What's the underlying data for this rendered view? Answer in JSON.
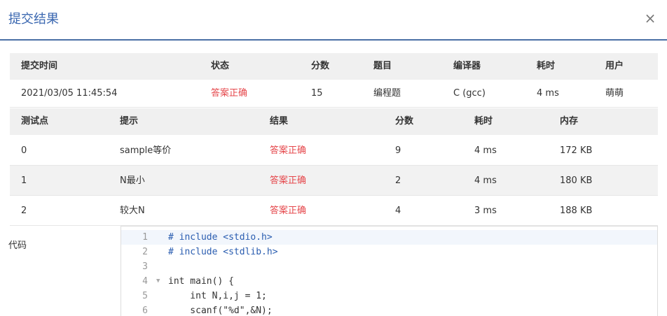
{
  "title": "提交结果",
  "close_label": "×",
  "summary": {
    "headers": [
      "提交时间",
      "状态",
      "分数",
      "题目",
      "编译器",
      "耗时",
      "用户"
    ],
    "row": {
      "time": "2021/03/05 11:45:54",
      "status": "答案正确",
      "score": "15",
      "problem": "编程题",
      "compiler": "C (gcc)",
      "elapsed": "4 ms",
      "user": "萌萌"
    }
  },
  "testcases": {
    "headers": [
      "测试点",
      "提示",
      "结果",
      "分数",
      "耗时",
      "内存"
    ],
    "rows": [
      {
        "id": "0",
        "hint": "sample等价",
        "result": "答案正确",
        "score": "9",
        "time": "4 ms",
        "memory": "172 KB"
      },
      {
        "id": "1",
        "hint": "N最小",
        "result": "答案正确",
        "score": "2",
        "time": "4 ms",
        "memory": "180 KB"
      },
      {
        "id": "2",
        "hint": "较大N",
        "result": "答案正确",
        "score": "4",
        "time": "3 ms",
        "memory": "188 KB"
      }
    ]
  },
  "code": {
    "label": "代码",
    "lines": [
      {
        "n": "1",
        "text": "# include <stdio.h>"
      },
      {
        "n": "2",
        "text": "# include <stdlib.h>"
      },
      {
        "n": "3",
        "text": ""
      },
      {
        "n": "4",
        "text": "int main() {"
      },
      {
        "n": "5",
        "text": "    int N,i,j = 1;"
      },
      {
        "n": "6",
        "text": "    scanf(\"%d\",&N);"
      }
    ]
  },
  "colors": {
    "title": "#3a67b0",
    "status_ok": "#e5474b",
    "header_bg": "#f0f0f0",
    "alt_row_bg": "#f2f2f2"
  }
}
